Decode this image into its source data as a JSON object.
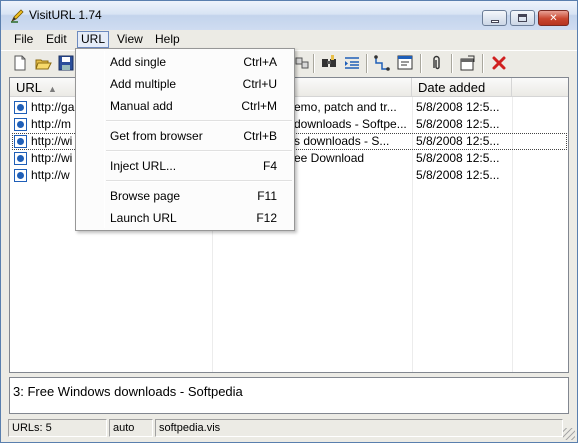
{
  "window": {
    "title": "VisitURL 1.74",
    "minimize_icon": "minimize-icon",
    "maximize_icon": "maximize-icon",
    "close_icon": "close-icon"
  },
  "menubar": {
    "items": [
      "File",
      "Edit",
      "URL",
      "View",
      "Help"
    ],
    "active": "URL"
  },
  "toolbar": {
    "icons": [
      "new-icon",
      "open-icon",
      "save-icon",
      "filter-icon",
      "find-icon",
      "indent-icon",
      "link-icon",
      "browser-icon",
      "attach-icon",
      "properties-icon",
      "delete-icon"
    ]
  },
  "url_menu": {
    "groups": [
      [
        {
          "label": "Add single",
          "shortcut": "Ctrl+A"
        },
        {
          "label": "Add multiple",
          "shortcut": "Ctrl+U"
        },
        {
          "label": "Manual add",
          "shortcut": "Ctrl+M"
        }
      ],
      [
        {
          "label": "Get from browser",
          "shortcut": "Ctrl+B"
        }
      ],
      [
        {
          "label": "Inject URL...",
          "shortcut": "F4"
        }
      ],
      [
        {
          "label": "Browse page",
          "shortcut": "F11"
        },
        {
          "label": "Launch URL",
          "shortcut": "F12"
        }
      ]
    ]
  },
  "list": {
    "columns": [
      "URL",
      "",
      "Date added"
    ],
    "rows": [
      {
        "url": "http://ga",
        "title": "emo, patch and tr...",
        "date": "5/8/2008 12:5..."
      },
      {
        "url": "http://m",
        "title": "downloads - Softpe...",
        "date": "5/8/2008 12:5..."
      },
      {
        "url": "http://wi",
        "title": "s downloads - S...",
        "date": "5/8/2008 12:5..."
      },
      {
        "url": "http://wi",
        "title": "ee Download",
        "date": "5/8/2008 12:5..."
      },
      {
        "url": "http://w",
        "title": "",
        "date": "5/8/2008 12:5..."
      }
    ],
    "focused_row": 2
  },
  "info": {
    "text": "3: Free Windows downloads - Softpedia"
  },
  "status": {
    "count": "URLs: 5",
    "mode": "auto",
    "file": "softpedia.vis"
  },
  "colors": {
    "accent": "#6d8bbf",
    "close": "#c9462f",
    "row_icon": "#1f5fb8"
  }
}
